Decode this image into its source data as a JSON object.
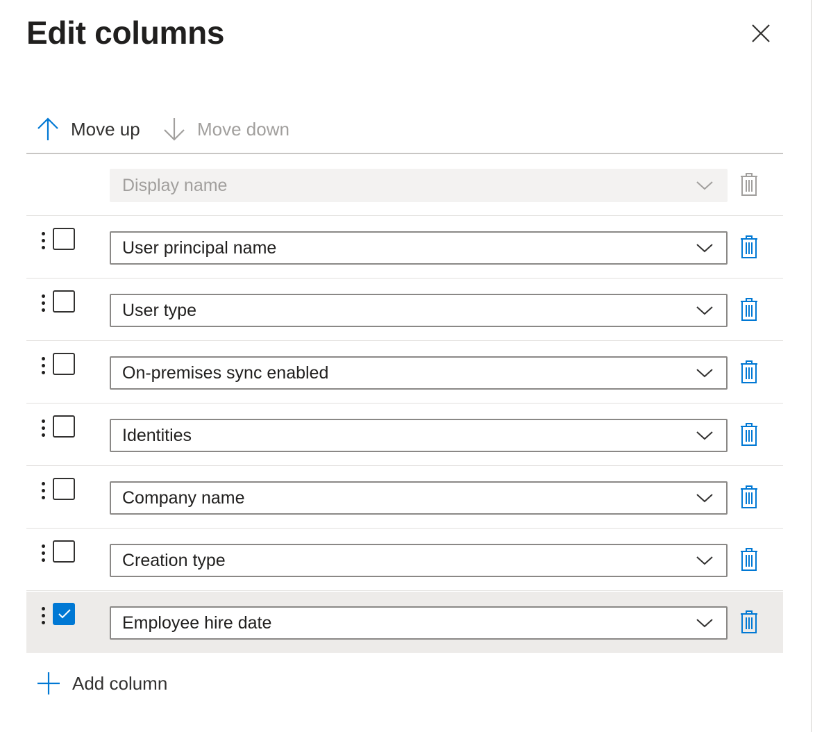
{
  "panel": {
    "title": "Edit columns",
    "close_icon": "close-icon"
  },
  "toolbar": {
    "move_up_label": "Move up",
    "move_down_label": "Move down",
    "move_up_icon": "arrow-up-icon",
    "move_down_icon": "arrow-down-icon",
    "move_down_enabled": false
  },
  "fixed_column": {
    "value": "Display name",
    "disabled": true
  },
  "columns": [
    {
      "value": "User principal name",
      "checked": false
    },
    {
      "value": "User type",
      "checked": false
    },
    {
      "value": "On-premises sync enabled",
      "checked": false
    },
    {
      "value": "Identities",
      "checked": false
    },
    {
      "value": "Company name",
      "checked": false
    },
    {
      "value": "Creation type",
      "checked": false
    },
    {
      "value": "Employee hire date",
      "checked": true
    }
  ],
  "add_column": {
    "label": "Add column",
    "icon": "plus-icon"
  },
  "colors": {
    "accent": "#0078d4",
    "text": "#323130",
    "disabled_text": "#a19f9d",
    "selected_row_bg": "#edebe9"
  }
}
